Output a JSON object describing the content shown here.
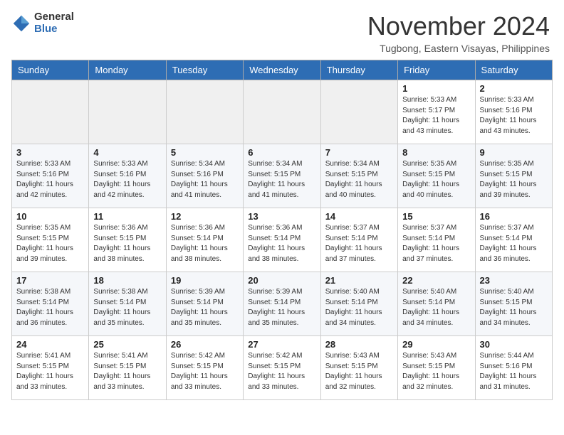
{
  "header": {
    "logo_general": "General",
    "logo_blue": "Blue",
    "month_title": "November 2024",
    "location": "Tugbong, Eastern Visayas, Philippines"
  },
  "weekdays": [
    "Sunday",
    "Monday",
    "Tuesday",
    "Wednesday",
    "Thursday",
    "Friday",
    "Saturday"
  ],
  "weeks": [
    [
      {
        "day": "",
        "info": ""
      },
      {
        "day": "",
        "info": ""
      },
      {
        "day": "",
        "info": ""
      },
      {
        "day": "",
        "info": ""
      },
      {
        "day": "",
        "info": ""
      },
      {
        "day": "1",
        "info": "Sunrise: 5:33 AM\nSunset: 5:17 PM\nDaylight: 11 hours\nand 43 minutes."
      },
      {
        "day": "2",
        "info": "Sunrise: 5:33 AM\nSunset: 5:16 PM\nDaylight: 11 hours\nand 43 minutes."
      }
    ],
    [
      {
        "day": "3",
        "info": "Sunrise: 5:33 AM\nSunset: 5:16 PM\nDaylight: 11 hours\nand 42 minutes."
      },
      {
        "day": "4",
        "info": "Sunrise: 5:33 AM\nSunset: 5:16 PM\nDaylight: 11 hours\nand 42 minutes."
      },
      {
        "day": "5",
        "info": "Sunrise: 5:34 AM\nSunset: 5:16 PM\nDaylight: 11 hours\nand 41 minutes."
      },
      {
        "day": "6",
        "info": "Sunrise: 5:34 AM\nSunset: 5:15 PM\nDaylight: 11 hours\nand 41 minutes."
      },
      {
        "day": "7",
        "info": "Sunrise: 5:34 AM\nSunset: 5:15 PM\nDaylight: 11 hours\nand 40 minutes."
      },
      {
        "day": "8",
        "info": "Sunrise: 5:35 AM\nSunset: 5:15 PM\nDaylight: 11 hours\nand 40 minutes."
      },
      {
        "day": "9",
        "info": "Sunrise: 5:35 AM\nSunset: 5:15 PM\nDaylight: 11 hours\nand 39 minutes."
      }
    ],
    [
      {
        "day": "10",
        "info": "Sunrise: 5:35 AM\nSunset: 5:15 PM\nDaylight: 11 hours\nand 39 minutes."
      },
      {
        "day": "11",
        "info": "Sunrise: 5:36 AM\nSunset: 5:15 PM\nDaylight: 11 hours\nand 38 minutes."
      },
      {
        "day": "12",
        "info": "Sunrise: 5:36 AM\nSunset: 5:14 PM\nDaylight: 11 hours\nand 38 minutes."
      },
      {
        "day": "13",
        "info": "Sunrise: 5:36 AM\nSunset: 5:14 PM\nDaylight: 11 hours\nand 38 minutes."
      },
      {
        "day": "14",
        "info": "Sunrise: 5:37 AM\nSunset: 5:14 PM\nDaylight: 11 hours\nand 37 minutes."
      },
      {
        "day": "15",
        "info": "Sunrise: 5:37 AM\nSunset: 5:14 PM\nDaylight: 11 hours\nand 37 minutes."
      },
      {
        "day": "16",
        "info": "Sunrise: 5:37 AM\nSunset: 5:14 PM\nDaylight: 11 hours\nand 36 minutes."
      }
    ],
    [
      {
        "day": "17",
        "info": "Sunrise: 5:38 AM\nSunset: 5:14 PM\nDaylight: 11 hours\nand 36 minutes."
      },
      {
        "day": "18",
        "info": "Sunrise: 5:38 AM\nSunset: 5:14 PM\nDaylight: 11 hours\nand 35 minutes."
      },
      {
        "day": "19",
        "info": "Sunrise: 5:39 AM\nSunset: 5:14 PM\nDaylight: 11 hours\nand 35 minutes."
      },
      {
        "day": "20",
        "info": "Sunrise: 5:39 AM\nSunset: 5:14 PM\nDaylight: 11 hours\nand 35 minutes."
      },
      {
        "day": "21",
        "info": "Sunrise: 5:40 AM\nSunset: 5:14 PM\nDaylight: 11 hours\nand 34 minutes."
      },
      {
        "day": "22",
        "info": "Sunrise: 5:40 AM\nSunset: 5:14 PM\nDaylight: 11 hours\nand 34 minutes."
      },
      {
        "day": "23",
        "info": "Sunrise: 5:40 AM\nSunset: 5:15 PM\nDaylight: 11 hours\nand 34 minutes."
      }
    ],
    [
      {
        "day": "24",
        "info": "Sunrise: 5:41 AM\nSunset: 5:15 PM\nDaylight: 11 hours\nand 33 minutes."
      },
      {
        "day": "25",
        "info": "Sunrise: 5:41 AM\nSunset: 5:15 PM\nDaylight: 11 hours\nand 33 minutes."
      },
      {
        "day": "26",
        "info": "Sunrise: 5:42 AM\nSunset: 5:15 PM\nDaylight: 11 hours\nand 33 minutes."
      },
      {
        "day": "27",
        "info": "Sunrise: 5:42 AM\nSunset: 5:15 PM\nDaylight: 11 hours\nand 33 minutes."
      },
      {
        "day": "28",
        "info": "Sunrise: 5:43 AM\nSunset: 5:15 PM\nDaylight: 11 hours\nand 32 minutes."
      },
      {
        "day": "29",
        "info": "Sunrise: 5:43 AM\nSunset: 5:15 PM\nDaylight: 11 hours\nand 32 minutes."
      },
      {
        "day": "30",
        "info": "Sunrise: 5:44 AM\nSunset: 5:16 PM\nDaylight: 11 hours\nand 31 minutes."
      }
    ]
  ]
}
